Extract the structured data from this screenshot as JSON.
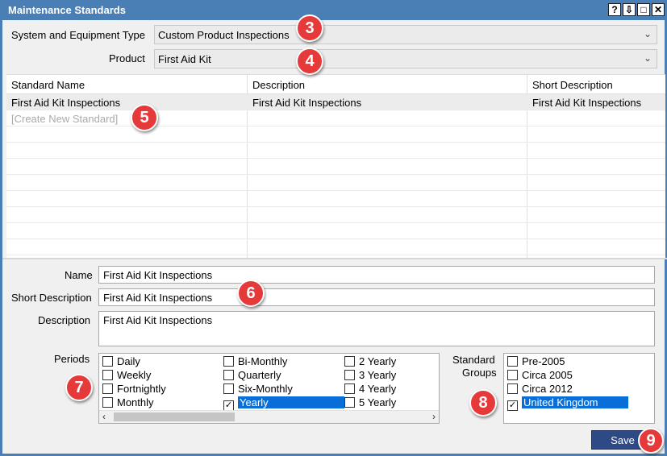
{
  "window": {
    "title": "Maintenance Standards",
    "buttons": [
      "?",
      "⇩",
      "□",
      "✕"
    ]
  },
  "filters": {
    "system_label": "System and Equipment Type",
    "system_value": "Custom Product Inspections",
    "product_label": "Product",
    "product_value": "First Aid Kit"
  },
  "grid": {
    "columns": [
      "Standard Name",
      "Description",
      "Short Description"
    ],
    "rows": [
      [
        "First Aid Kit Inspections",
        "First Aid Kit Inspections",
        "First Aid Kit Inspections"
      ]
    ],
    "new_row": "[Create New Standard]"
  },
  "form": {
    "name_label": "Name",
    "name_value": "First Aid Kit Inspections",
    "short_label": "Short Description",
    "short_value": "First Aid Kit Inspections",
    "desc_label": "Description",
    "desc_value": "First Aid Kit Inspections"
  },
  "periods": {
    "label": "Periods",
    "items": [
      {
        "label": "Daily",
        "checked": false
      },
      {
        "label": "Weekly",
        "checked": false
      },
      {
        "label": "Fortnightly",
        "checked": false
      },
      {
        "label": "Monthly",
        "checked": false
      },
      {
        "label": "Bi-Monthly",
        "checked": false
      },
      {
        "label": "Quarterly",
        "checked": false
      },
      {
        "label": "Six-Monthly",
        "checked": false
      },
      {
        "label": "Yearly",
        "checked": true
      },
      {
        "label": "2 Yearly",
        "checked": false
      },
      {
        "label": "3 Yearly",
        "checked": false
      },
      {
        "label": "4 Yearly",
        "checked": false
      },
      {
        "label": "5 Yearly",
        "checked": false
      }
    ]
  },
  "groups": {
    "label_line1": "Standard",
    "label_line2": "Groups",
    "items": [
      {
        "label": "Pre-2005",
        "checked": false
      },
      {
        "label": "Circa 2005",
        "checked": false
      },
      {
        "label": "Circa 2012",
        "checked": false
      },
      {
        "label": "United Kingdom",
        "checked": true
      }
    ]
  },
  "actions": {
    "save_label": "Save"
  },
  "callouts": [
    "3",
    "4",
    "5",
    "6",
    "7",
    "8",
    "9"
  ],
  "colors": {
    "titlebar": "#4a7fb5",
    "selection": "#0a6ed8",
    "callout": "#e6393a",
    "save": "#2d4a86"
  }
}
